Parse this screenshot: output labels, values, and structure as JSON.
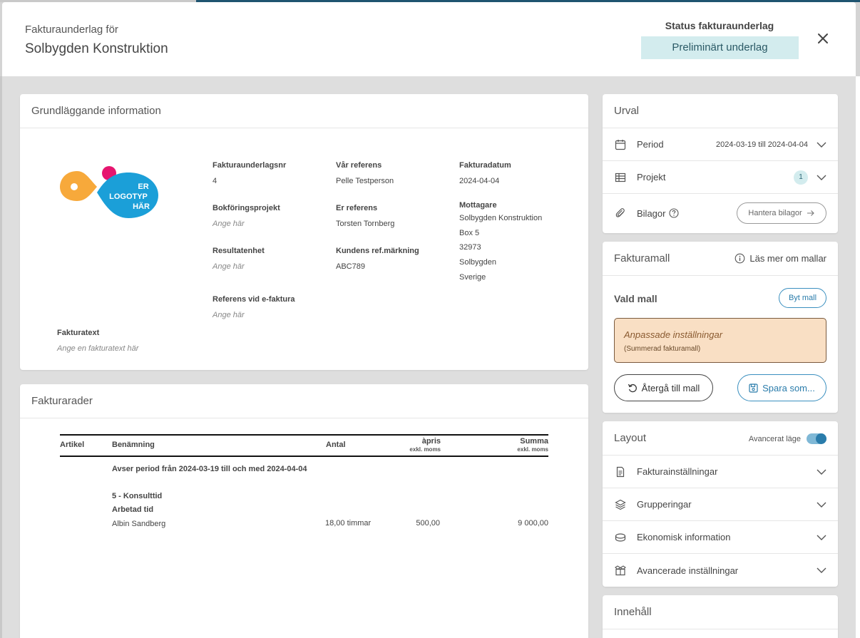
{
  "header": {
    "subtitle": "Fakturaunderlag för",
    "title": "Solbygden Konstruktion",
    "status_label": "Status fakturaunderlag",
    "status_value": "Preliminärt underlag"
  },
  "info": {
    "title": "Grundläggande information",
    "logo_text": [
      "ER",
      "LOGOTYP",
      "HÄR"
    ],
    "fakturaunderlagsnr_label": "Fakturaunderlagsnr",
    "fakturaunderlagsnr_value": "4",
    "bokforingsprojekt_label": "Bokföringsprojekt",
    "bokforingsprojekt_placeholder": "Ange här",
    "resultatenhet_label": "Resultatenhet",
    "resultatenhet_placeholder": "Ange här",
    "referens_efaktura_label": "Referens vid e-faktura",
    "referens_efaktura_placeholder": "Ange här",
    "var_referens_label": "Vår referens",
    "var_referens_value": "Pelle Testperson",
    "er_referens_label": "Er referens",
    "er_referens_value": "Torsten Tornberg",
    "kundens_ref_label": "Kundens ref.märkning",
    "kundens_ref_value": "ABC789",
    "fakturadatum_label": "Fakturadatum",
    "fakturadatum_value": "2024-04-04",
    "mottagare_label": "Mottagare",
    "mottagare_lines": [
      "Solbygden Konstruktion",
      "Box 5",
      "32973",
      "Solbygden",
      "Sverige"
    ],
    "fakturatext_label": "Fakturatext",
    "fakturatext_placeholder": "Ange en fakturatext här"
  },
  "rows": {
    "title": "Fakturarader",
    "col_artikel": "Artikel",
    "col_benamning": "Benämning",
    "col_antal": "Antal",
    "col_apris": "àpris",
    "col_apris_sub": "exkl. moms",
    "col_summa": "Summa",
    "col_summa_sub": "exkl. moms",
    "period_text": "Avser period från 2024-03-19 till och med 2024-04-04",
    "group_title": "5 - Konsulttid",
    "group_sub": "Arbetad tid",
    "line_name": "Albin Sandberg",
    "line_antal": "18,00 timmar",
    "line_apris": "500,00",
    "line_summa": "9 000,00"
  },
  "urval": {
    "title": "Urval",
    "period_label": "Period",
    "period_value": "2024-03-19 till 2024-04-04",
    "projekt_label": "Projekt",
    "projekt_count": "1",
    "bilagor_label": "Bilagor",
    "hantera_bilagor": "Hantera bilagor"
  },
  "fakturamall": {
    "title": "Fakturamall",
    "info_link": "Läs mer om mallar",
    "vald_mall": "Vald mall",
    "byt_mall": "Byt mall",
    "anpassade": "Anpassade inställningar",
    "summerad": "(Summerad fakturamall)",
    "atergå": "Återgå till mall",
    "spara": "Spara som..."
  },
  "layout": {
    "title": "Layout",
    "toggle_label": "Avancerat läge",
    "toggle_on": true,
    "items": [
      {
        "label": "Fakturainställningar",
        "icon": "document-icon"
      },
      {
        "label": "Grupperingar",
        "icon": "layers-icon"
      },
      {
        "label": "Ekonomisk information",
        "icon": "coins-icon"
      },
      {
        "label": "Avancerade inställningar",
        "icon": "box-icon"
      }
    ]
  },
  "innehall": {
    "title": "Innehåll"
  },
  "colors": {
    "status_bg": "#d3ecee",
    "accent": "#2a7cab",
    "warning_bg": "#f9dfc4",
    "logo_orange": "#f7a93b",
    "logo_blue": "#1b9fd8",
    "logo_pink": "#e6156f"
  }
}
